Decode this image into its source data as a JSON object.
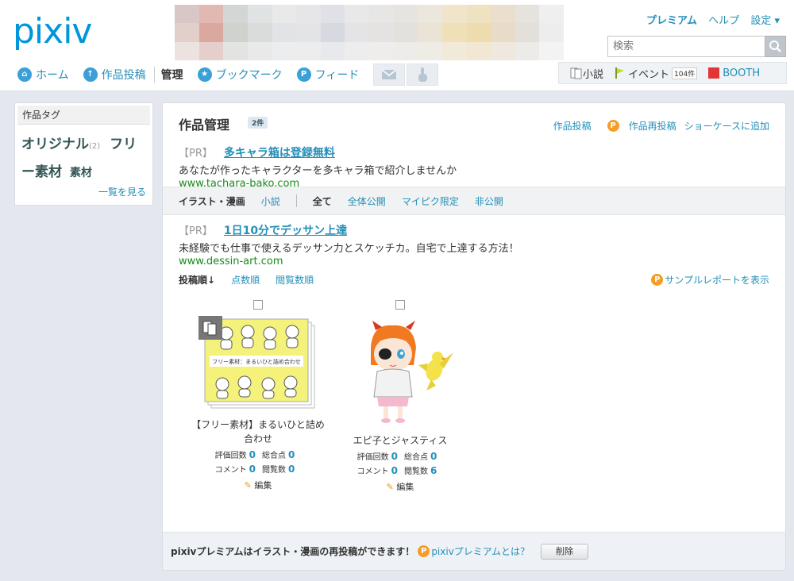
{
  "logo": "pixiv",
  "header": {
    "premium": "プレミアム",
    "help": "ヘルプ",
    "settings": "設定 ▾",
    "search_placeholder": "検索"
  },
  "nav": {
    "home": "ホーム",
    "post": "作品投稿",
    "manage": "管理",
    "bookmark": "ブックマーク",
    "feed": "フィード"
  },
  "right_nav": {
    "novel": "小説",
    "event": "イベント",
    "event_count": "104件",
    "booth": "BOOTH"
  },
  "sidebar": {
    "title": "作品タグ",
    "tag1": "オリジナル",
    "tag1_count": "(2)",
    "tag2": "フリー素材",
    "tag3": "素材",
    "more": "一覧を見る"
  },
  "main": {
    "title": "作品管理",
    "count": "2件",
    "action_post": "作品投稿",
    "action_repost": "作品再投稿",
    "action_showcase": "ショーケースに追加"
  },
  "ad1": {
    "pr": "【PR】",
    "title": "多キャラ箱は登録無料",
    "desc": "あなたが作ったキャラクターを多キャラ箱で紹介しませんか",
    "url": "www.tachara-bako.com"
  },
  "filter": {
    "illust": "イラスト・漫画",
    "novel": "小説",
    "all": "全て",
    "public": "全体公開",
    "mypixiv": "マイピク限定",
    "private": "非公開"
  },
  "ad2": {
    "pr": "【PR】",
    "title": "1日10分でデッサン上達",
    "desc": "未経験でも仕事で使えるデッサン力とスケッチカ。自宅で上達する方法！",
    "url": "www.dessin-art.com"
  },
  "sort": {
    "posted": "投稿順↓",
    "score": "点数順",
    "views": "閲覧数順",
    "sample_report": "サンプルレポートを表示"
  },
  "works": [
    {
      "title": "【フリー素材】まるいひと詰め合わせ",
      "rating_label": "評価回数",
      "rating": "0",
      "total_label": "総合点",
      "total": "0",
      "comment_label": "コメント",
      "comment": "0",
      "views_label": "閲覧数",
      "views": "0",
      "edit": "編集",
      "thumb_caption": "フリー素材：まるいひと詰め合わせ"
    },
    {
      "title": "エピ子とジャスティス",
      "rating_label": "評価回数",
      "rating": "0",
      "total_label": "総合点",
      "total": "0",
      "comment_label": "コメント",
      "comment": "0",
      "views_label": "閲覧数",
      "views": "6",
      "edit": "編集"
    }
  ],
  "footer": {
    "text": "pixivプレミアムはイラスト・漫画の再投稿ができます！",
    "link": "pixivプレミアムとは？",
    "delete": "削除"
  },
  "colors": {
    "accent": "#258fb8",
    "logo": "#0096db",
    "premium_orange": "#f59d24",
    "url_green": "#1a8a1a"
  }
}
